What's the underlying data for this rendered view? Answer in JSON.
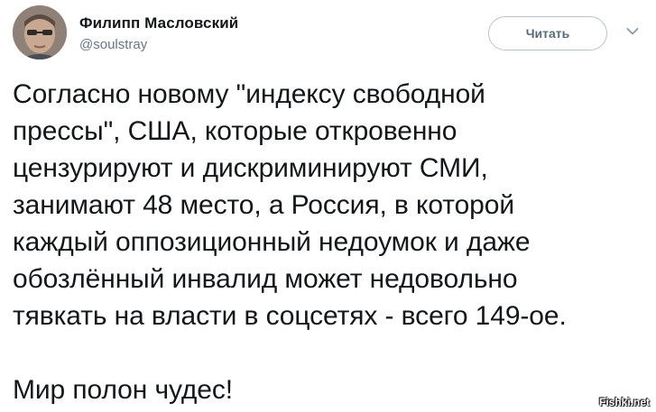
{
  "tweet": {
    "author": {
      "display_name": "Филипп Масловский",
      "username": "@soulstray",
      "avatar_icon": "user-avatar-photo"
    },
    "follow_button_label": "Читать",
    "more_menu_icon": "chevron-down-icon",
    "text_lines": [
      "Согласно новому \"индексу свободной",
      "прессы\", США, которые откровенно",
      "цензурируют и дискриминируют СМИ,",
      "занимают 48 место, а Россия, в которой",
      "каждый оппозиционный недоумок и даже",
      "обозлённый инвалид может недовольно",
      "тявкать на власти в соцсетях - всего 149-ое."
    ],
    "closing_line": "Мир полон чудес!"
  },
  "watermark": "Fishki.net",
  "colors": {
    "accent": "#1da1f2",
    "text": "#14171a",
    "secondary_text": "#657786",
    "button_border": "#b9c3cb"
  }
}
